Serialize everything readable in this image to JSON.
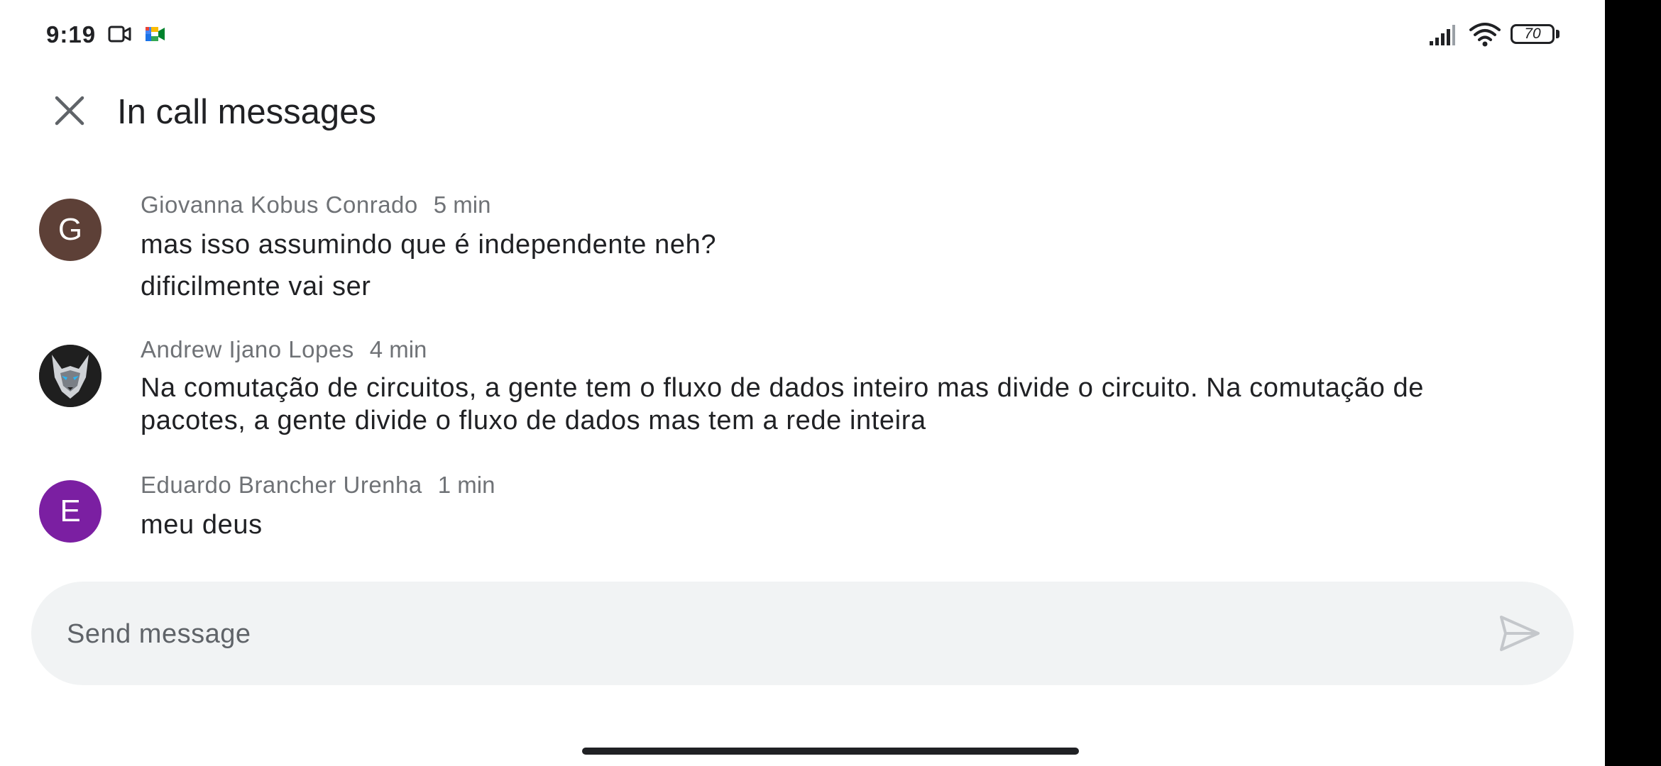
{
  "status_bar": {
    "time": "9:19",
    "battery": "70",
    "icons": [
      "video-camera-outline-icon",
      "google-meet-icon",
      "signal-icon",
      "wifi-icon",
      "battery-icon"
    ]
  },
  "header": {
    "title": "In call messages",
    "close_icon": "close-icon"
  },
  "messages": [
    {
      "avatar_letter": "G",
      "avatar_color": "#5d4037",
      "sender": "Giovanna Kobus Conrado",
      "time": "5 min",
      "lines": [
        "mas isso assumindo que é independente neh?",
        "dificilmente vai ser"
      ]
    },
    {
      "avatar_letter": "",
      "avatar_color": "#2b2b2b",
      "avatar_icon": "wolf-avatar-icon",
      "sender": "Andrew Ijano Lopes",
      "time": "4 min",
      "lines": [
        "Na comutação de circuitos, a gente tem o fluxo de dados inteiro mas divide o circuito. Na comutação de pacotes, a gente divide o fluxo de dados mas tem a rede inteira"
      ]
    },
    {
      "avatar_letter": "E",
      "avatar_color": "#7b1fa2",
      "sender": "Eduardo Brancher Urenha",
      "time": "1 min",
      "lines": [
        "meu deus"
      ]
    }
  ],
  "composer": {
    "placeholder": "Send message",
    "value": "",
    "send_icon": "send-icon"
  },
  "colors": {
    "background": "#ffffff",
    "text": "#202124",
    "secondary_text": "#6f7276",
    "composer_bg": "#f1f3f4"
  }
}
